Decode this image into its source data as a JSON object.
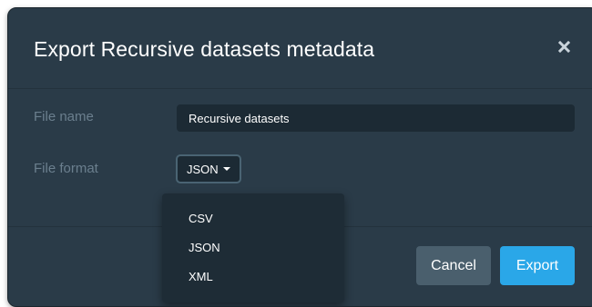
{
  "modal": {
    "title": "Export Recursive datasets metadata",
    "close_icon": "close-icon"
  },
  "form": {
    "file_name_label": "File name",
    "file_name_value": "Recursive datasets",
    "file_format_label": "File format",
    "file_format_selected": "JSON"
  },
  "format_dropdown": {
    "open": true,
    "options": [
      "CSV",
      "JSON",
      "XML"
    ]
  },
  "footer": {
    "cancel_label": "Cancel",
    "export_label": "Export"
  },
  "colors": {
    "modal_background": "#2a3b48",
    "input_background": "#1c2a34",
    "label_text": "#6b7f8e",
    "cancel_button": "#4a5f6d",
    "export_button": "#2aa7e8"
  }
}
